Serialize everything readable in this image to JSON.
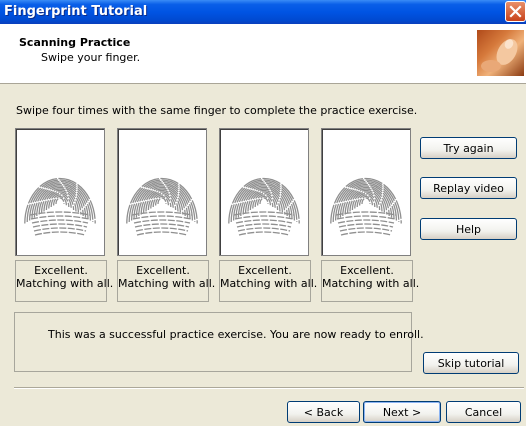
{
  "window": {
    "title": "Fingerprint Tutorial"
  },
  "header": {
    "title": "Scanning Practice",
    "subtitle": "Swipe your finger."
  },
  "instructions": "Swipe four times with the same finger to complete the practice exercise.",
  "scans": [
    {
      "line1": "Excellent.",
      "line2": "Matching with all."
    },
    {
      "line1": "Excellent.",
      "line2": "Matching with all."
    },
    {
      "line1": "Excellent.",
      "line2": "Matching with all."
    },
    {
      "line1": "Excellent.",
      "line2": "Matching with all."
    }
  ],
  "result_message": "This was a successful practice exercise. You are now ready to enroll.",
  "side_buttons": {
    "try_again": "Try again",
    "replay_video": "Replay video",
    "help": "Help",
    "skip_tutorial": "Skip tutorial"
  },
  "nav_buttons": {
    "back": "< Back",
    "next": "Next >",
    "cancel": "Cancel"
  },
  "icons": {
    "close": "close-icon",
    "header_image": "finger-photo-icon",
    "fingerprint": "fingerprint-icon"
  }
}
